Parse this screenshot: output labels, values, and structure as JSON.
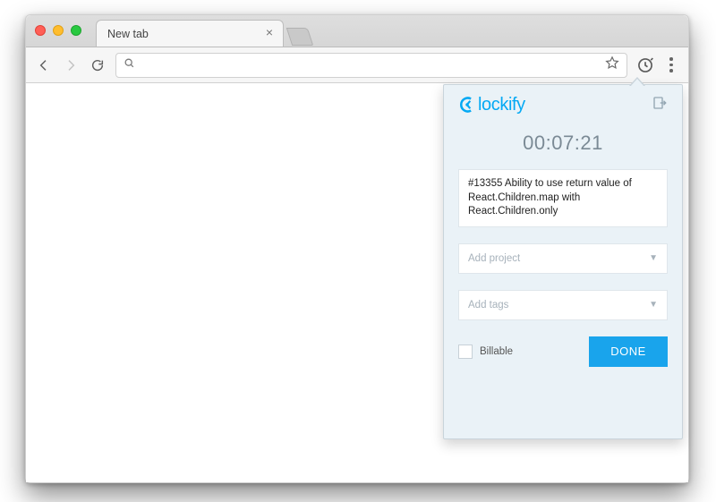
{
  "browser": {
    "tab_title": "New tab",
    "omnibox_value": ""
  },
  "popup": {
    "brand": "lockify",
    "timer": "00:07:21",
    "task_description": "#13355 Ability to use return value of React.Children.map with React.Children.only",
    "project_placeholder": "Add project",
    "tags_placeholder": "Add tags",
    "billable_label": "Billable",
    "done_label": "DONE"
  }
}
